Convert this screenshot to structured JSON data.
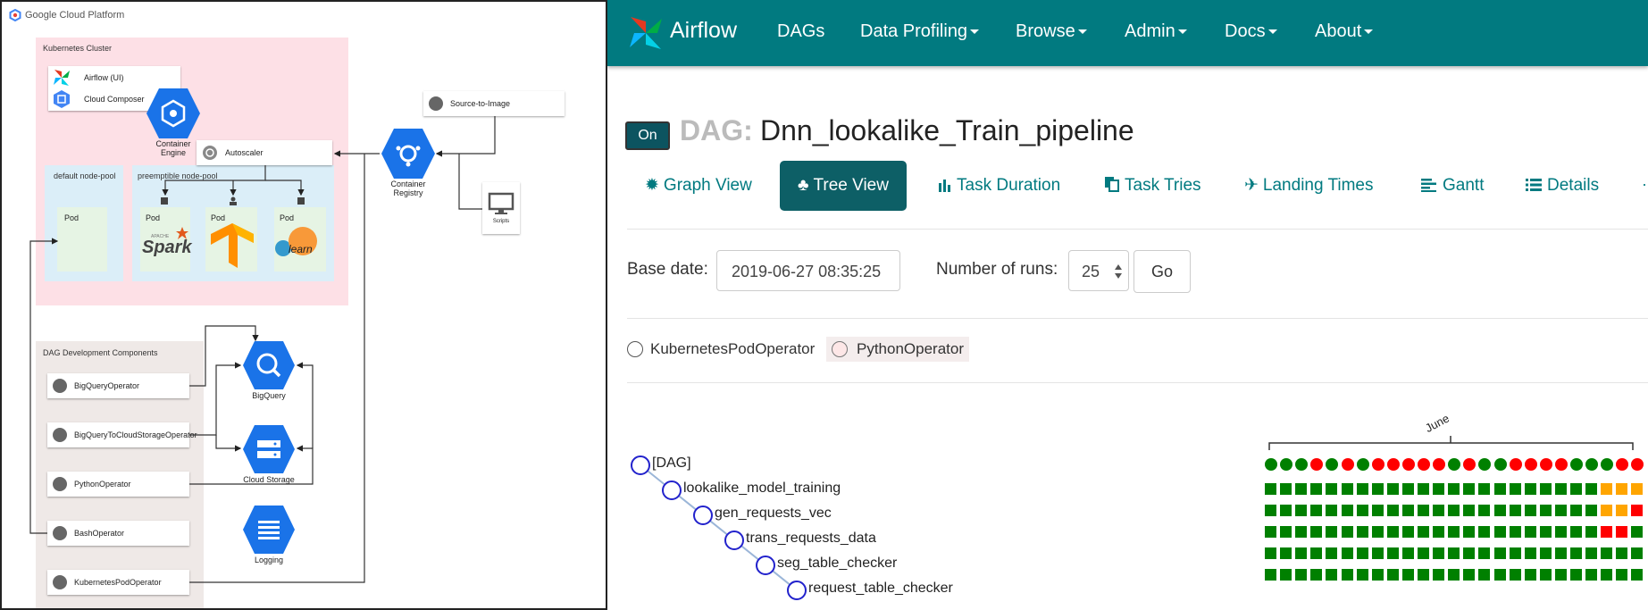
{
  "diagram": {
    "brand": "Google Cloud Platform",
    "regions": {
      "kubernetes": "Kubernetes Cluster",
      "default_pool": "default node-pool",
      "preemptible_pool": "preemptible node-pool",
      "dag_components": "DAG Development Components"
    },
    "cards": {
      "airflow_ui": "Airflow (UI)",
      "cloud_composer": "Cloud Composer",
      "autoscaler": "Autoscaler",
      "source_to_image": "Source-to-Image"
    },
    "pod_label": "Pod",
    "hex_labels": {
      "container_engine": "Container Engine",
      "container_registry": "Container Registry",
      "bigquery": "BigQuery",
      "cloud_storage": "Cloud Storage",
      "logging": "Logging"
    },
    "scripts_label": "Scripts",
    "spark_tag": "APACHE",
    "spark_label": "Spark",
    "sklearn_label": "learn",
    "operators": [
      "BigQueryOperator",
      "BigQueryToCloudStorageOperator",
      "PythonOperator",
      "BashOperator",
      "KubernetesPodOperator"
    ]
  },
  "airflow": {
    "brand": "Airflow",
    "nav": [
      "DAGs",
      "Data Profiling",
      "Browse",
      "Admin",
      "Docs",
      "About"
    ],
    "toggle": "On",
    "dag_prefix": "DAG:",
    "dag_name": "Dnn_lookalike_Train_pipeline",
    "tabs": [
      "Graph View",
      "Tree View",
      "Task Duration",
      "Task Tries",
      "Landing Times",
      "Gantt",
      "Details"
    ],
    "base_date_label": "Base date:",
    "base_date_value": "2019-06-27 08:35:25",
    "runs_label": "Number of runs:",
    "runs_value": "25",
    "go": "Go",
    "legend": [
      "KubernetesPodOperator",
      "PythonOperator"
    ],
    "month": "June",
    "tasks": [
      "[DAG]",
      "lookalike_model_training",
      "gen_requests_vec",
      "trans_requests_data",
      "seg_table_checker",
      "request_table_checker"
    ],
    "colors": {
      "success": "#008000",
      "failed": "#ff0000",
      "upstream_failed": "#ffa500",
      "teal": "#017a80"
    },
    "dag_runs": [
      "g",
      "g",
      "g",
      "r",
      "g",
      "r",
      "g",
      "r",
      "r",
      "r",
      "r",
      "r",
      "g",
      "r",
      "g",
      "g",
      "r",
      "r",
      "r",
      "r",
      "g",
      "g",
      "g",
      "r",
      "r"
    ],
    "task_states": [
      [
        "g",
        "g",
        "g",
        "g",
        "g",
        "g",
        "g",
        "g",
        "g",
        "g",
        "g",
        "g",
        "g",
        "g",
        "g",
        "g",
        "g",
        "g",
        "g",
        "g",
        "g",
        "g",
        "o",
        "o",
        "o"
      ],
      [
        "g",
        "g",
        "g",
        "g",
        "g",
        "g",
        "g",
        "g",
        "g",
        "g",
        "g",
        "g",
        "g",
        "g",
        "g",
        "g",
        "g",
        "g",
        "g",
        "g",
        "g",
        "g",
        "o",
        "o",
        "r"
      ],
      [
        "g",
        "g",
        "g",
        "g",
        "g",
        "g",
        "g",
        "g",
        "g",
        "g",
        "g",
        "g",
        "g",
        "g",
        "g",
        "g",
        "g",
        "g",
        "g",
        "g",
        "g",
        "g",
        "r",
        "r",
        "g"
      ],
      [
        "g",
        "g",
        "g",
        "g",
        "g",
        "g",
        "g",
        "g",
        "g",
        "g",
        "g",
        "g",
        "g",
        "g",
        "g",
        "g",
        "g",
        "g",
        "g",
        "g",
        "g",
        "g",
        "g",
        "g",
        "g"
      ],
      [
        "g",
        "g",
        "g",
        "g",
        "g",
        "g",
        "g",
        "g",
        "g",
        "g",
        "g",
        "g",
        "g",
        "g",
        "g",
        "g",
        "g",
        "g",
        "g",
        "g",
        "g",
        "g",
        "g",
        "g",
        "g"
      ]
    ]
  }
}
